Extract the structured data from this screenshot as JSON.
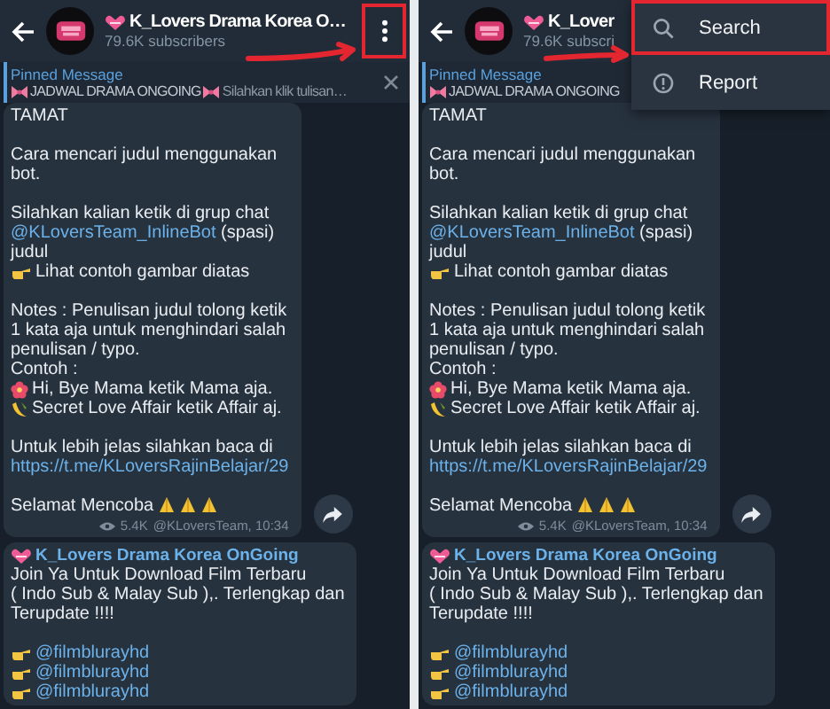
{
  "panes": [
    {
      "header": {
        "title": "K_Lovers Drama Korea O…",
        "subscribers": "79.6K subscribers",
        "menu_button": {
          "highlighted": true
        }
      },
      "pinned": {
        "label": "Pinned Message",
        "preview": "JADWAL DRAMA ONGOING",
        "trailing": "Silahkan klik tulisan…",
        "closable": true
      },
      "annotation_arrow": true,
      "messages": [
        {
          "paragraphs": [
            {
              "lines": [
                {
                  "parts": [
                    {
                      "text": "TAMAT"
                    }
                  ]
                }
              ]
            },
            {
              "lines": [
                {
                  "parts": [
                    {
                      "text": "Cara mencari judul menggunakan"
                    }
                  ]
                },
                {
                  "parts": [
                    {
                      "text": "bot."
                    }
                  ]
                }
              ]
            },
            {
              "lines": [
                {
                  "parts": [
                    {
                      "text": "Silahkan kalian ketik di grup chat"
                    }
                  ]
                },
                {
                  "parts": [
                    {
                      "text": "@KLoversTeam_InlineBot",
                      "link": true
                    },
                    {
                      "text": " (spasi)"
                    }
                  ]
                },
                {
                  "parts": [
                    {
                      "text": "judul"
                    }
                  ]
                },
                {
                  "bullet": {
                    "kind": "pointer"
                  },
                  "parts": [
                    {
                      "text": "Lihat contoh gambar diatas"
                    }
                  ]
                }
              ]
            },
            {
              "lines": [
                {
                  "parts": [
                    {
                      "text": "Notes : Penulisan judul tolong ketik"
                    }
                  ]
                },
                {
                  "parts": [
                    {
                      "text": "1 kata aja untuk menghindari salah"
                    }
                  ]
                },
                {
                  "parts": [
                    {
                      "text": "penulisan / typo."
                    }
                  ]
                },
                {
                  "parts": [
                    {
                      "text": "Contoh :"
                    }
                  ]
                },
                {
                  "bullet": {
                    "kind": "flower"
                  },
                  "parts": [
                    {
                      "text": "Hi, Bye Mama ketik Mama aja."
                    }
                  ]
                },
                {
                  "bullet": {
                    "kind": "banana"
                  },
                  "parts": [
                    {
                      "text": "Secret Love Affair ketik Affair aj."
                    }
                  ]
                }
              ]
            },
            {
              "lines": [
                {
                  "parts": [
                    {
                      "text": "Untuk lebih jelas silahkan baca di"
                    }
                  ]
                },
                {
                  "parts": [
                    {
                      "text": "https://t.me/KLoversRajinBelajar/29",
                      "link": true
                    }
                  ]
                }
              ]
            },
            {
              "lines": [
                {
                  "parts": [
                    {
                      "text": "Selamat Mencoba"
                    }
                  ],
                  "trailing": [
                    {
                      "kind": "pray"
                    },
                    {
                      "kind": "pray"
                    },
                    {
                      "kind": "pray"
                    }
                  ]
                }
              ]
            }
          ],
          "views": "5.4K",
          "signature": "@KLoversTeam, 10:34",
          "shareable": true
        },
        {
          "channel": "K_Lovers Drama Korea OnGoing",
          "paragraphs": [
            {
              "lines": [
                {
                  "parts": [
                    {
                      "text": "Join Ya Untuk Download Film Terbaru"
                    }
                  ]
                },
                {
                  "parts": [
                    {
                      "text": "( Indo Sub & Malay Sub ),. Terlengkap dan"
                    }
                  ]
                },
                {
                  "parts": [
                    {
                      "text": "Terupdate !!!!"
                    }
                  ]
                }
              ]
            },
            {
              "lines": [
                {
                  "bullet": {
                    "kind": "pointer"
                  },
                  "parts": [
                    {
                      "text": "@filmblurayhd",
                      "link": true
                    }
                  ]
                },
                {
                  "bullet": {
                    "kind": "pointer"
                  },
                  "parts": [
                    {
                      "text": "@filmblurayhd",
                      "link": true
                    }
                  ]
                },
                {
                  "bullet": {
                    "kind": "pointer"
                  },
                  "parts": [
                    {
                      "text": "@filmblurayhd",
                      "link": true
                    }
                  ]
                }
              ]
            }
          ]
        }
      ]
    },
    {
      "header": {
        "title": "K_Lover",
        "subscribers": "79.6K subscri"
      },
      "pinned": {
        "label": "Pinned Message",
        "preview": "JADWAL DRAMA ONGOING"
      },
      "annotation_arrow": true,
      "menu": {
        "items": [
          {
            "kind": "search",
            "label": "Search",
            "highlighted": true
          },
          {
            "kind": "report",
            "label": "Report",
            "highlighted": false
          }
        ]
      },
      "messages": [
        {
          "paragraphs": [
            {
              "lines": [
                {
                  "parts": [
                    {
                      "text": "TAMAT"
                    }
                  ]
                }
              ]
            },
            {
              "lines": [
                {
                  "parts": [
                    {
                      "text": "Cara mencari judul menggunakan"
                    }
                  ]
                },
                {
                  "parts": [
                    {
                      "text": "bot."
                    }
                  ]
                }
              ]
            },
            {
              "lines": [
                {
                  "parts": [
                    {
                      "text": "Silahkan kalian ketik di grup chat"
                    }
                  ]
                },
                {
                  "parts": [
                    {
                      "text": "@KLoversTeam_InlineBot",
                      "link": true
                    },
                    {
                      "text": " (spasi)"
                    }
                  ]
                },
                {
                  "parts": [
                    {
                      "text": "judul"
                    }
                  ]
                },
                {
                  "bullet": {
                    "kind": "pointer"
                  },
                  "parts": [
                    {
                      "text": "Lihat contoh gambar diatas"
                    }
                  ]
                }
              ]
            },
            {
              "lines": [
                {
                  "parts": [
                    {
                      "text": "Notes : Penulisan judul tolong ketik"
                    }
                  ]
                },
                {
                  "parts": [
                    {
                      "text": "1 kata aja untuk menghindari salah"
                    }
                  ]
                },
                {
                  "parts": [
                    {
                      "text": "penulisan / typo."
                    }
                  ]
                },
                {
                  "parts": [
                    {
                      "text": "Contoh :"
                    }
                  ]
                },
                {
                  "bullet": {
                    "kind": "flower"
                  },
                  "parts": [
                    {
                      "text": "Hi, Bye Mama ketik Mama aja."
                    }
                  ]
                },
                {
                  "bullet": {
                    "kind": "banana"
                  },
                  "parts": [
                    {
                      "text": "Secret Love Affair ketik Affair aj."
                    }
                  ]
                }
              ]
            },
            {
              "lines": [
                {
                  "parts": [
                    {
                      "text": "Untuk lebih jelas silahkan baca di"
                    }
                  ]
                },
                {
                  "parts": [
                    {
                      "text": "https://t.me/KLoversRajinBelajar/29",
                      "link": true
                    }
                  ]
                }
              ]
            },
            {
              "lines": [
                {
                  "parts": [
                    {
                      "text": "Selamat Mencoba"
                    }
                  ],
                  "trailing": [
                    {
                      "kind": "pray"
                    },
                    {
                      "kind": "pray"
                    },
                    {
                      "kind": "pray"
                    }
                  ]
                }
              ]
            }
          ],
          "views": "5.4K",
          "signature": "@KLoversTeam, 10:34",
          "shareable": true
        },
        {
          "channel": "K_Lovers Drama Korea OnGoing",
          "paragraphs": [
            {
              "lines": [
                {
                  "parts": [
                    {
                      "text": "Join Ya Untuk Download Film Terbaru"
                    }
                  ]
                },
                {
                  "parts": [
                    {
                      "text": "( Indo Sub & Malay Sub ),. Terlengkap dan"
                    }
                  ]
                },
                {
                  "parts": [
                    {
                      "text": "Terupdate !!!!"
                    }
                  ]
                }
              ]
            },
            {
              "lines": [
                {
                  "bullet": {
                    "kind": "pointer"
                  },
                  "parts": [
                    {
                      "text": "@filmblurayhd",
                      "link": true
                    }
                  ]
                },
                {
                  "bullet": {
                    "kind": "pointer"
                  },
                  "parts": [
                    {
                      "text": "@filmblurayhd",
                      "link": true
                    }
                  ]
                },
                {
                  "bullet": {
                    "kind": "pointer"
                  },
                  "parts": [
                    {
                      "text": "@filmblurayhd",
                      "link": true
                    }
                  ]
                }
              ]
            }
          ]
        }
      ]
    }
  ]
}
